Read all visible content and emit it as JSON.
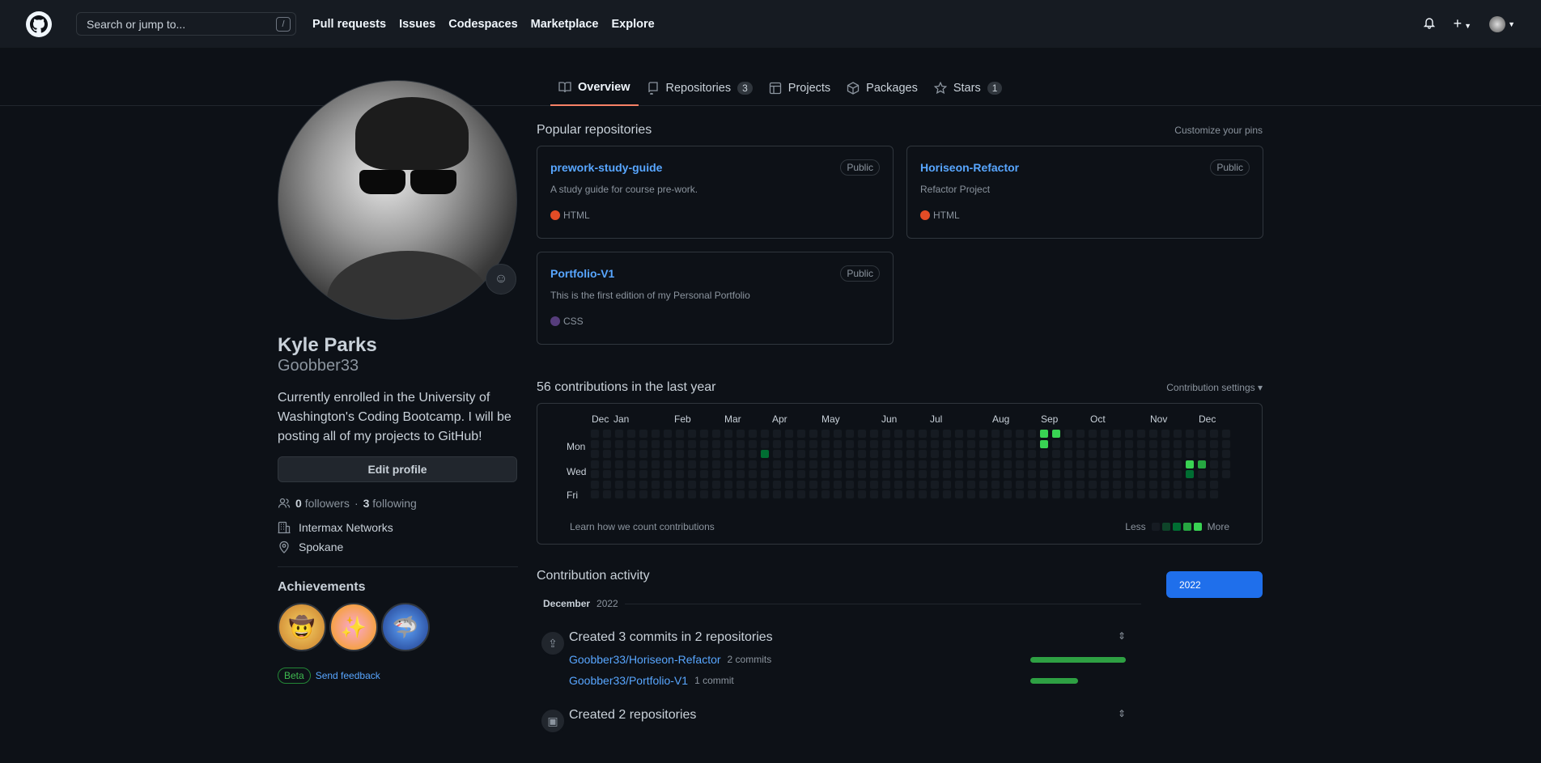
{
  "header": {
    "search_placeholder": "Search or jump to...",
    "search_shortcut": "/",
    "nav": [
      "Pull requests",
      "Issues",
      "Codespaces",
      "Marketplace",
      "Explore"
    ]
  },
  "tabs": [
    {
      "label": "Overview",
      "icon": "book-icon",
      "active": true
    },
    {
      "label": "Repositories",
      "icon": "repo-icon",
      "count": "3"
    },
    {
      "label": "Projects",
      "icon": "table-icon"
    },
    {
      "label": "Packages",
      "icon": "package-icon"
    },
    {
      "label": "Stars",
      "icon": "star-icon",
      "count": "1"
    }
  ],
  "profile": {
    "name": "Kyle Parks",
    "login": "Goobber33",
    "bio": "Currently enrolled in the University of Washington's Coding Bootcamp. I will be posting all of my projects to GitHub!",
    "edit_label": "Edit profile",
    "followers": "0",
    "followers_label": "followers",
    "following": "3",
    "following_label": "following",
    "company": "Intermax Networks",
    "location": "Spokane",
    "achievements_title": "Achievements",
    "beta": "Beta",
    "feedback": "Send feedback"
  },
  "popular": {
    "title": "Popular repositories",
    "customize": "Customize your pins",
    "repos": [
      {
        "name": "prework-study-guide",
        "visibility": "Public",
        "desc": "A study guide for course pre-work.",
        "lang": "HTML",
        "color": "#e34c26"
      },
      {
        "name": "Horiseon-Refactor",
        "visibility": "Public",
        "desc": "Refactor Project",
        "lang": "HTML",
        "color": "#e34c26"
      },
      {
        "name": "Portfolio-V1",
        "visibility": "Public",
        "desc": "This is the first edition of my Personal Portfolio",
        "lang": "CSS",
        "color": "#563d7c"
      }
    ]
  },
  "contributions": {
    "title": "56 contributions in the last year",
    "settings": "Contribution settings ▾",
    "months": [
      "Dec",
      "Jan",
      "Feb",
      "Mar",
      "Apr",
      "May",
      "Jun",
      "Jul",
      "Aug",
      "Sep",
      "Oct",
      "Nov",
      "Dec"
    ],
    "days": [
      "Mon",
      "Wed",
      "Fri"
    ],
    "learn": "Learn how we count contributions",
    "less": "Less",
    "more": "More"
  },
  "activity": {
    "title": "Contribution activity",
    "year": "2022",
    "month": "December",
    "month_year": "2022",
    "commits_head": "Created 3 commits in 2 repositories",
    "commit_repos": [
      {
        "name": "Goobber33/Horiseon-Refactor",
        "count": "2 commits",
        "share": 0.667
      },
      {
        "name": "Goobber33/Portfolio-V1",
        "count": "1 commit",
        "share": 0.333
      }
    ],
    "repos_head": "Created 2 repositories"
  }
}
